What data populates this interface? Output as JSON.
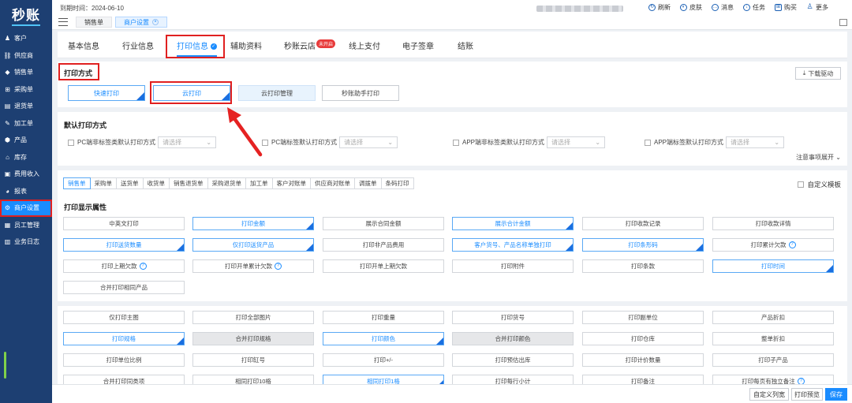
{
  "app": {
    "logo": "秒账"
  },
  "sidebar": {
    "items": [
      {
        "label": "客户",
        "icon": "person-icon"
      },
      {
        "label": "供应商",
        "icon": "supplier-icon"
      },
      {
        "label": "销售单",
        "icon": "tag-icon"
      },
      {
        "label": "采购单",
        "icon": "cart-icon"
      },
      {
        "label": "退货单",
        "icon": "return-icon"
      },
      {
        "label": "加工单",
        "icon": "tool-icon"
      },
      {
        "label": "产品",
        "icon": "box-icon"
      },
      {
        "label": "库存",
        "icon": "warehouse-icon"
      },
      {
        "label": "费用收入",
        "icon": "money-icon"
      },
      {
        "label": "报表",
        "icon": "chart-icon"
      },
      {
        "label": "商户设置",
        "icon": "gear-icon"
      },
      {
        "label": "员工管理",
        "icon": "staff-icon"
      },
      {
        "label": "业务日志",
        "icon": "log-icon"
      }
    ]
  },
  "topbar": {
    "expire": "到期时间：2024-06-10",
    "tabs": [
      "销售单",
      "商户设置"
    ],
    "tools": [
      "刷新",
      "皮肤",
      "消息",
      "任务",
      "购买",
      "更多"
    ]
  },
  "info_tabs": [
    "基本信息",
    "行业信息",
    "打印信息",
    "辅助资料",
    "秒账云店",
    "线上支付",
    "电子签章",
    "结账"
  ],
  "badge": "未开启",
  "print_method": {
    "title": "打印方式",
    "buttons": [
      "快速打印",
      "云打印",
      "云打印管理",
      "秒账助手打印"
    ],
    "download": "下载驱动"
  },
  "default_print": {
    "title": "默认打印方式",
    "items": [
      {
        "label": "PC端非标签类默认打印方式",
        "placeholder": "请选择"
      },
      {
        "label": "PC端标签默认打印方式",
        "placeholder": "请选择"
      },
      {
        "label": "APP端非标签类默认打印方式",
        "placeholder": "请选择"
      },
      {
        "label": "APP端标签默认打印方式",
        "placeholder": "请选择"
      }
    ],
    "notes": "注意事项展开"
  },
  "attrs": {
    "doc_tabs": [
      "销售单",
      "采购单",
      "送货单",
      "收货单",
      "销售退货单",
      "采购退货单",
      "加工单",
      "客户对账单",
      "供应商对账单",
      "调拨单",
      "条码打印"
    ],
    "custom_template": "自定义模板",
    "title": "打印显示属性",
    "row1": [
      "中英文打印",
      "打印金额",
      "展示合同金额",
      "展示合计金额",
      "打印收款记录",
      "打印收款详情"
    ],
    "row2": [
      "打印送货数量",
      "仅打印送货产品",
      "打印非产品费用",
      "客户货号、产品名称单独打印",
      "打印条形码",
      "打印累计欠款"
    ],
    "row3": [
      "打印上期欠款",
      "打印开单累计欠款",
      "打印开单上期欠款",
      "打印附件",
      "打印条款",
      "打印时间"
    ],
    "row4": [
      "合并打印相同产品"
    ],
    "row5": [
      "仅打印主图",
      "打印全部图片",
      "打印重量",
      "打印货号",
      "打印副单位",
      "产品折扣"
    ],
    "row6": [
      "打印规格",
      "合并打印规格",
      "打印颜色",
      "合并打印颜色",
      "打印仓库",
      "整单折扣"
    ],
    "row7": [
      "打印单位比例",
      "打印缸号",
      "打印+/-",
      "打印预估出库",
      "打印计价数量",
      "打印子产品"
    ],
    "row8": [
      "合并打印同类项",
      "相同打印10格",
      "相同打印1格",
      "打印每行小计",
      "打印备注",
      "打印每页有独立备注"
    ]
  },
  "footer": {
    "buttons": [
      "自定义列宽",
      "打印预览",
      "保存"
    ]
  }
}
